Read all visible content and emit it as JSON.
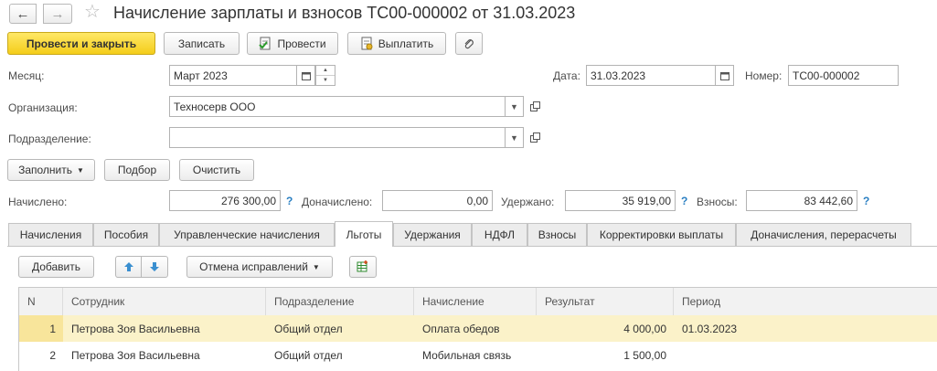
{
  "header": {
    "title": "Начисление зарплаты и взносов ТС00-000002 от 31.03.2023"
  },
  "toolbar": {
    "post_close": "Провести и закрыть",
    "save": "Записать",
    "post": "Провести",
    "pay": "Выплатить"
  },
  "form": {
    "month_label": "Месяц:",
    "month_value": "Март 2023",
    "date_label": "Дата:",
    "date_value": "31.03.2023",
    "number_label": "Номер:",
    "number_value": "ТС00-000002",
    "org_label": "Организация:",
    "org_value": "Техносерв ООО",
    "dept_label": "Подразделение:",
    "dept_value": ""
  },
  "actions": {
    "fill": "Заполнить",
    "select": "Подбор",
    "clear": "Очистить"
  },
  "totals": {
    "accrued_label": "Начислено:",
    "accrued_value": "276 300,00",
    "extra_label": "Доначислено:",
    "extra_value": "0,00",
    "withheld_label": "Удержано:",
    "withheld_value": "35 919,00",
    "contrib_label": "Взносы:",
    "contrib_value": "83 442,60",
    "help": "?"
  },
  "tabs": [
    "Начисления",
    "Пособия",
    "Управленческие начисления",
    "Льготы",
    "Удержания",
    "НДФЛ",
    "Взносы",
    "Корректировки выплаты",
    "Доначисления, перерасчеты"
  ],
  "active_tab": "Льготы",
  "table_toolbar": {
    "add": "Добавить",
    "cancel_fixes": "Отмена исправлений"
  },
  "table": {
    "columns": [
      "N",
      "Сотрудник",
      "Подразделение",
      "Начисление",
      "Результат",
      "Период"
    ],
    "rows": [
      {
        "n": "1",
        "employee": "Петрова Зоя Васильевна",
        "dept": "Общий отдел",
        "accrual": "Оплата обедов",
        "result": "4 000,00",
        "period": "01.03.2023"
      },
      {
        "n": "2",
        "employee": "Петрова Зоя Васильевна",
        "dept": "Общий отдел",
        "accrual": "Мобильная связь",
        "result": "1 500,00",
        "period": ""
      }
    ]
  },
  "colors": {
    "accent_yellow": "#f4cd1a",
    "selected_row": "#fbf2c9",
    "help_blue": "#2a7fc2"
  }
}
